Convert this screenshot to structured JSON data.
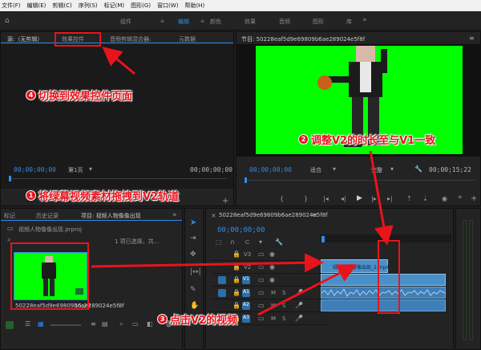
{
  "menu": [
    "文件(F)",
    "编辑(E)",
    "剪辑(C)",
    "序列(S)",
    "标记(M)",
    "图形(G)",
    "窗口(W)",
    "帮助(H)"
  ],
  "workspace_tabs": [
    "组件",
    "编辑",
    "颜色",
    "效果",
    "音频",
    "图形",
    "库"
  ],
  "workspace_more": "»",
  "source_panel": {
    "tabs": [
      "源:（无剪辑）",
      "效果控件",
      "音频剪辑混合器:",
      "元数据"
    ],
    "timecode_left": "00;00;00;00",
    "page": "第1页",
    "timecode_right": "00;00;00;00"
  },
  "program_panel": {
    "title": "节目: 50228eaf5d9e69809b6ae289024e5f8f",
    "timecode_left": "00;00;00;00",
    "fit": "适合",
    "quality": "完整",
    "timecode_right": "00;00;15;22"
  },
  "project_panel": {
    "tabs": [
      "标记",
      "历史记录",
      "项目: 视频人物像像出现"
    ],
    "project_file": "视频人物像像出现.prproj",
    "selection_info": "1 项已选择，共...",
    "clip_duration": "15;22"
  },
  "timeline": {
    "sequence_name": "50228eaf5d9e69809b6ae289024e5f8f",
    "timecode": "00;00;00;00",
    "tracks": [
      "V3",
      "V2",
      "V1",
      "A1",
      "A2",
      "A3"
    ],
    "clip_v2_label": "绿幕人物像像出现_2.mp4",
    "track_m": "M",
    "track_s": "S"
  },
  "annotations": [
    {
      "num": "1",
      "text": "将绿幕视频素材拖拽到V2轨道"
    },
    {
      "num": "2",
      "text": "调整V2的时长至与V1一致"
    },
    {
      "num": "3",
      "text": "点击V2的视频"
    },
    {
      "num": "4",
      "text": "切换到效果控件页面"
    }
  ],
  "colors": {
    "accent": "#2d8ceb",
    "annotation_red": "#e8141c",
    "green_screen": "#00ff00",
    "clip_blue": "#4a90c8",
    "clip_audio": "#3f7fb8"
  }
}
